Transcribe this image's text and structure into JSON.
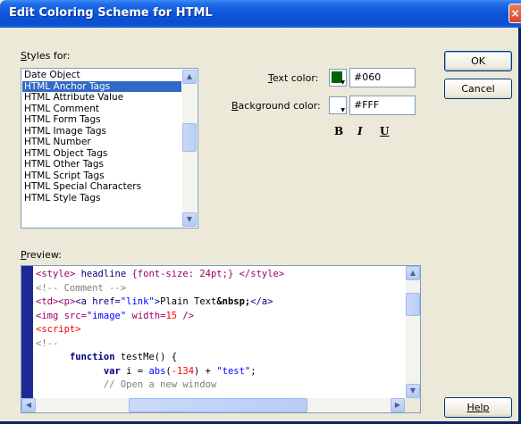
{
  "window": {
    "title": "Edit Coloring Scheme for HTML",
    "close_glyph": "×"
  },
  "styles": {
    "label": "Styles for:",
    "label_accel": "S",
    "label_rest": "tyles for:",
    "items": [
      "Date Object",
      "HTML Anchor Tags",
      "HTML Attribute Value",
      "HTML Comment",
      "HTML Form Tags",
      "HTML Image Tags",
      "HTML Number",
      "HTML Object Tags",
      "HTML Other Tags",
      "HTML Script Tags",
      "HTML Special Characters",
      "HTML Style Tags"
    ],
    "selected_index": 1
  },
  "text_color": {
    "label_accel": "T",
    "label_rest": "ext color:",
    "value": "#060",
    "swatch": "#006600"
  },
  "background_color": {
    "label_accel": "B",
    "label_rest": "ackground color:",
    "value": "#FFF",
    "swatch": "#ffffff"
  },
  "format": {
    "bold": "B",
    "italic": "I",
    "underline": "U"
  },
  "buttons": {
    "ok": "OK",
    "cancel": "Cancel",
    "help": "Help"
  },
  "preview": {
    "label": "Preview:",
    "label_accel": "P",
    "label_rest": "review:",
    "lines": [
      [
        {
          "c": "tag",
          "t": "<style>"
        },
        {
          "c": "attr",
          "t": " headline "
        },
        {
          "c": "tag",
          "t": "{font-size: 24pt;}"
        },
        {
          "c": "attr",
          "t": " "
        },
        {
          "c": "tag",
          "t": "</style>"
        }
      ],
      [
        {
          "c": "cmt",
          "t": "<!-- Comment -->"
        }
      ],
      [
        {
          "c": "tag",
          "t": "<td>"
        },
        {
          "c": "tag",
          "t": "<p>"
        },
        {
          "c": "attr",
          "t": "<a href="
        },
        {
          "c": "val",
          "t": "\"link\""
        },
        {
          "c": "attr",
          "t": ">"
        },
        {
          "c": "txt",
          "t": "Plain Text"
        },
        {
          "c": "ent",
          "t": "&nbsp;"
        },
        {
          "c": "attr",
          "t": "</a>"
        }
      ],
      [
        {
          "c": "tag",
          "t": "<img src="
        },
        {
          "c": "val",
          "t": "\"image\""
        },
        {
          "c": "tag",
          "t": " width="
        },
        {
          "c": "num",
          "t": "15"
        },
        {
          "c": "tag",
          "t": " />"
        }
      ],
      [
        {
          "c": "num",
          "t": "<script>"
        }
      ],
      [
        {
          "c": "cmt",
          "t": "<!--"
        }
      ],
      [
        {
          "c": "plain",
          "t": "      "
        },
        {
          "c": "kw",
          "t": "function"
        },
        {
          "c": "plain",
          "t": " testMe() {"
        }
      ],
      [
        {
          "c": "plain",
          "t": "            "
        },
        {
          "c": "kw",
          "t": "var"
        },
        {
          "c": "plain",
          "t": " i = "
        },
        {
          "c": "fn",
          "t": "abs"
        },
        {
          "c": "plain",
          "t": "("
        },
        {
          "c": "num",
          "t": "-134"
        },
        {
          "c": "plain",
          "t": ") + "
        },
        {
          "c": "str",
          "t": "\"test\""
        },
        {
          "c": "plain",
          "t": ";"
        }
      ],
      [
        {
          "c": "plain",
          "t": "            "
        },
        {
          "c": "cmt",
          "t": "// Open a new window"
        }
      ]
    ]
  }
}
